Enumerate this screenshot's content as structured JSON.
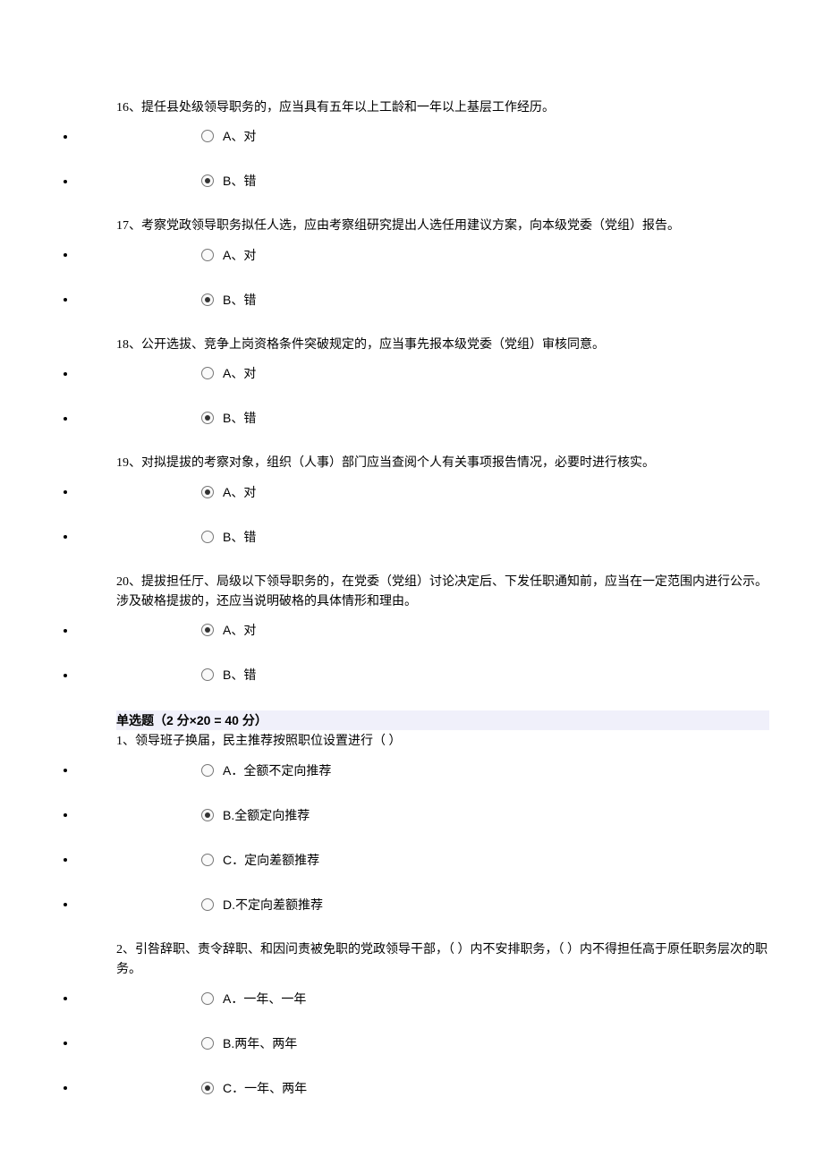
{
  "sections": [
    {
      "type": "questions",
      "items": [
        {
          "text": "16、提任县处级领导职务的，应当具有五年以上工龄和一年以上基层工作经历。",
          "options": [
            {
              "label": "A、对",
              "selected": false
            },
            {
              "label": "B、错",
              "selected": true
            }
          ]
        },
        {
          "text": "17、考察党政领导职务拟任人选，应由考察组研究提出人选任用建议方案，向本级党委（党组）报告。",
          "options": [
            {
              "label": "A、对",
              "selected": false
            },
            {
              "label": "B、错",
              "selected": true
            }
          ]
        },
        {
          "text": "18、公开选拔、竞争上岗资格条件突破规定的，应当事先报本级党委（党组）审核同意。",
          "options": [
            {
              "label": "A、对",
              "selected": false
            },
            {
              "label": "B、错",
              "selected": true
            }
          ]
        },
        {
          "text": "19、对拟提拔的考察对象，组织（人事）部门应当查阅个人有关事项报告情况，必要时进行核实。",
          "options": [
            {
              "label": "A、对",
              "selected": true
            },
            {
              "label": "B、错",
              "selected": false
            }
          ]
        },
        {
          "text": "20、提拔担任厅、局级以下领导职务的，在党委（党组）讨论决定后、下发任职通知前，应当在一定范围内进行公示。涉及破格提拔的，还应当说明破格的具体情形和理由。",
          "options": [
            {
              "label": "A、对",
              "selected": true
            },
            {
              "label": "B、错",
              "selected": false
            }
          ]
        }
      ]
    },
    {
      "type": "header",
      "text": "单选题（2 分×20 = 40 分）"
    },
    {
      "type": "questions",
      "items": [
        {
          "text": "1、领导班子换届，民主推荐按照职位设置进行（  ）",
          "options": [
            {
              "label": "A．全额不定向推荐",
              "selected": false
            },
            {
              "label": "B.全额定向推荐",
              "selected": true
            },
            {
              "label": "C．定向差额推荐",
              "selected": false
            },
            {
              "label": "D.不定向差额推荐",
              "selected": false
            }
          ]
        },
        {
          "text": "2、引咎辞职、责令辞职、和因问责被免职的党政领导干部，（  ）内不安排职务，（  ）内不得担任高于原任职务层次的职务。",
          "options": [
            {
              "label": "A．一年、一年",
              "selected": false
            },
            {
              "label": "B.两年、两年",
              "selected": false
            },
            {
              "label": "C．一年、两年",
              "selected": true
            }
          ]
        }
      ]
    }
  ]
}
